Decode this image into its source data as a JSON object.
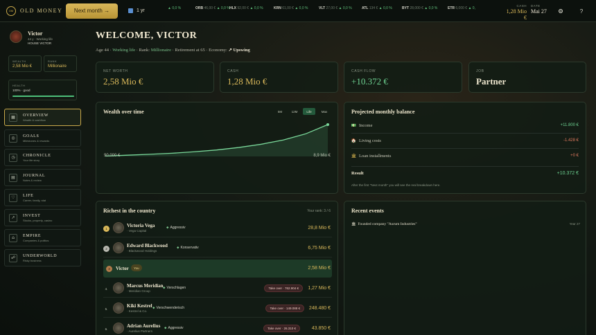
{
  "app": {
    "brand": "OLD MONEY",
    "logo_mark": "OM"
  },
  "topbar": {
    "next_label": "Next month →",
    "speed": "1 yr",
    "tickers": [
      {
        "sym": "",
        "price": "",
        "chg": "▲ 0,0 %"
      },
      {
        "sym": "ORB",
        "price": "46,00 €",
        "chg": "▲ 0,0 %"
      },
      {
        "sym": "HLX",
        "price": "92,00 €",
        "chg": "▲ 0,0 %"
      },
      {
        "sym": "KRN",
        "price": "61,00 €",
        "chg": "▲ 0,0 %"
      },
      {
        "sym": "VLT",
        "price": "27,00 €",
        "chg": "▲ 0,0 %"
      },
      {
        "sym": "ATL",
        "price": "134 €",
        "chg": "▲ 0,0 %"
      },
      {
        "sym": "BYT",
        "price": "28,000 €",
        "chg": "▲ 0,0 %"
      },
      {
        "sym": "ETR",
        "price": "6,000 €",
        "chg": "▲ 0,"
      }
    ],
    "cash_label": "CASH",
    "cash_value": "1,28 Mio €",
    "date_label": "DATE",
    "date_value": "Mai 27",
    "settings_icon": "gear-icon",
    "help_icon": "question-icon",
    "help_glyph": "?"
  },
  "profile": {
    "name": "Victor",
    "sub": "44 y · Working life",
    "house": "HOUSE VICTOR",
    "wealth_label": "WEALTH",
    "wealth_value": "2,58 Mio €",
    "rank_label": "RANK",
    "rank_value": "Millionaire",
    "health_label": "HEALTH",
    "health_value": "100% · good",
    "health_pct": 100
  },
  "nav": [
    {
      "title": "OVERVIEW",
      "sub": "Wealth & cashflow",
      "icon": "grid-icon",
      "glyph": "▦"
    },
    {
      "title": "GOALS",
      "sub": "Milestones & rewards",
      "icon": "target-icon",
      "glyph": "◎"
    },
    {
      "title": "CHRONICLE",
      "sub": "Your life story",
      "icon": "clock-icon",
      "glyph": "◷"
    },
    {
      "title": "JOURNAL",
      "sub": "Notes & review",
      "icon": "notebook-icon",
      "glyph": "▤"
    },
    {
      "title": "LIFE",
      "sub": "Career, family, stat",
      "icon": "heart-icon",
      "glyph": "♡"
    },
    {
      "title": "INVEST",
      "sub": "Stocks, property, casino",
      "icon": "chart-trend-icon",
      "glyph": "↗"
    },
    {
      "title": "EMPIRE",
      "sub": "Companies & politics",
      "icon": "building-icon",
      "glyph": "⌂"
    },
    {
      "title": "UNDERWORLD",
      "sub": "Risky business",
      "icon": "mask-icon",
      "glyph": "☍"
    }
  ],
  "header": {
    "welcome": "WELCOME, VICTOR",
    "age": "Age 44 · ",
    "stage": "Working life",
    "rank_prefix": " · Rank: ",
    "rank": "Millionaire",
    "retire": " · Retirement at 65 · Economy: ",
    "economy": "↗ Upswing"
  },
  "kpis": [
    {
      "label": "NET WORTH",
      "value": "2,58 Mio €"
    },
    {
      "label": "CASH",
      "value": "1,28 Mio €"
    },
    {
      "label": "CASH FLOW",
      "value": "+10.372 €"
    },
    {
      "label": "JOB",
      "value": "Partner"
    }
  ],
  "wealth_chart": {
    "title": "Wealth over time",
    "ranges": [
      "5M",
      "12M",
      "Life",
      "Max"
    ],
    "active_range": "Life",
    "start_label": "90.000 €",
    "end_label": "8,9 Mio €"
  },
  "chart_data": {
    "type": "area",
    "title": "Wealth over time",
    "xlabel": "",
    "ylabel": "",
    "x": [
      0,
      1,
      2,
      3,
      4,
      5,
      6,
      7,
      8,
      9,
      10
    ],
    "values": [
      0.09,
      0.35,
      0.6,
      0.9,
      1.3,
      1.8,
      2.5,
      3.4,
      4.6,
      6.3,
      8.9
    ]
  },
  "balance": {
    "title": "Projected monthly balance",
    "rows": [
      {
        "label": "Income",
        "value": "+11.800 €",
        "icon": "money-icon",
        "glyph": "💵"
      },
      {
        "label": "Living costs",
        "value": "-1.428 €",
        "icon": "house-icon",
        "glyph": "🏠"
      },
      {
        "label": "Loan installments",
        "value": "+0 €",
        "icon": "bank-icon",
        "glyph": "🏛"
      }
    ],
    "result_label": "Result",
    "result_value": "+10.372 €",
    "note": "After the first \"Next month\" you will see the real breakdown here."
  },
  "richest": {
    "title": "Richest in the country",
    "your_rank": "Your rank: 3 / 6",
    "rows": [
      {
        "rank": "1",
        "name": "Victoria Vega",
        "sub": "· Vega Capital",
        "tag": "Aggressiv",
        "value": "28,8 Mio €"
      },
      {
        "rank": "2",
        "name": "Edward Blackwood",
        "sub": "· Blackwood Holdings",
        "tag": "Konservativ",
        "value": "6,75 Mio €"
      },
      {
        "rank": "3",
        "name": "Victor",
        "you": "You",
        "value": "2,58 Mio €"
      },
      {
        "rank": "4.",
        "name": "Marcus Meridian",
        "sub": "· Meridian Group",
        "tag": "Verschlagen",
        "takeover": "Take over · 762.904 €",
        "value": "1,27 Mio €"
      },
      {
        "rank": "5.",
        "name": "Kiki Kestrel",
        "sub": "· Kestrel & Co.",
        "tag": "Verschwenderisch",
        "takeover": "Take over · 149.088 €",
        "value": "248.480 €"
      },
      {
        "rank": "6.",
        "name": "Adrian Aurelius",
        "sub": "· Aurelius Partners",
        "tag": "Aggressiv",
        "takeover": "Take over · 26.310 €",
        "value": "43.850 €"
      }
    ]
  },
  "events": {
    "title": "Recent events",
    "items": [
      {
        "text": "Founded company \"Aurum Industries\"",
        "time": "Year 27",
        "icon": "building-icon",
        "glyph": "🏛"
      }
    ]
  },
  "colors": {
    "accent_gold": "#d9b85a",
    "positive": "#6ed392",
    "negative": "#e07a5f",
    "active_row": "#1d3a27"
  }
}
